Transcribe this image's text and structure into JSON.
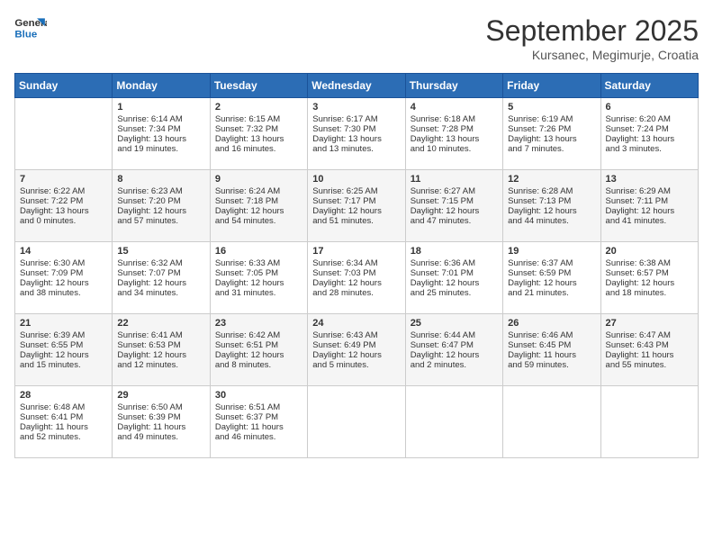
{
  "header": {
    "logo_line1": "General",
    "logo_line2": "Blue",
    "month": "September 2025",
    "location": "Kursanec, Megimurje, Croatia"
  },
  "days_of_week": [
    "Sunday",
    "Monday",
    "Tuesday",
    "Wednesday",
    "Thursday",
    "Friday",
    "Saturday"
  ],
  "weeks": [
    [
      {
        "day": "",
        "info": ""
      },
      {
        "day": "1",
        "info": "Sunrise: 6:14 AM\nSunset: 7:34 PM\nDaylight: 13 hours\nand 19 minutes."
      },
      {
        "day": "2",
        "info": "Sunrise: 6:15 AM\nSunset: 7:32 PM\nDaylight: 13 hours\nand 16 minutes."
      },
      {
        "day": "3",
        "info": "Sunrise: 6:17 AM\nSunset: 7:30 PM\nDaylight: 13 hours\nand 13 minutes."
      },
      {
        "day": "4",
        "info": "Sunrise: 6:18 AM\nSunset: 7:28 PM\nDaylight: 13 hours\nand 10 minutes."
      },
      {
        "day": "5",
        "info": "Sunrise: 6:19 AM\nSunset: 7:26 PM\nDaylight: 13 hours\nand 7 minutes."
      },
      {
        "day": "6",
        "info": "Sunrise: 6:20 AM\nSunset: 7:24 PM\nDaylight: 13 hours\nand 3 minutes."
      }
    ],
    [
      {
        "day": "7",
        "info": "Sunrise: 6:22 AM\nSunset: 7:22 PM\nDaylight: 13 hours\nand 0 minutes."
      },
      {
        "day": "8",
        "info": "Sunrise: 6:23 AM\nSunset: 7:20 PM\nDaylight: 12 hours\nand 57 minutes."
      },
      {
        "day": "9",
        "info": "Sunrise: 6:24 AM\nSunset: 7:18 PM\nDaylight: 12 hours\nand 54 minutes."
      },
      {
        "day": "10",
        "info": "Sunrise: 6:25 AM\nSunset: 7:17 PM\nDaylight: 12 hours\nand 51 minutes."
      },
      {
        "day": "11",
        "info": "Sunrise: 6:27 AM\nSunset: 7:15 PM\nDaylight: 12 hours\nand 47 minutes."
      },
      {
        "day": "12",
        "info": "Sunrise: 6:28 AM\nSunset: 7:13 PM\nDaylight: 12 hours\nand 44 minutes."
      },
      {
        "day": "13",
        "info": "Sunrise: 6:29 AM\nSunset: 7:11 PM\nDaylight: 12 hours\nand 41 minutes."
      }
    ],
    [
      {
        "day": "14",
        "info": "Sunrise: 6:30 AM\nSunset: 7:09 PM\nDaylight: 12 hours\nand 38 minutes."
      },
      {
        "day": "15",
        "info": "Sunrise: 6:32 AM\nSunset: 7:07 PM\nDaylight: 12 hours\nand 34 minutes."
      },
      {
        "day": "16",
        "info": "Sunrise: 6:33 AM\nSunset: 7:05 PM\nDaylight: 12 hours\nand 31 minutes."
      },
      {
        "day": "17",
        "info": "Sunrise: 6:34 AM\nSunset: 7:03 PM\nDaylight: 12 hours\nand 28 minutes."
      },
      {
        "day": "18",
        "info": "Sunrise: 6:36 AM\nSunset: 7:01 PM\nDaylight: 12 hours\nand 25 minutes."
      },
      {
        "day": "19",
        "info": "Sunrise: 6:37 AM\nSunset: 6:59 PM\nDaylight: 12 hours\nand 21 minutes."
      },
      {
        "day": "20",
        "info": "Sunrise: 6:38 AM\nSunset: 6:57 PM\nDaylight: 12 hours\nand 18 minutes."
      }
    ],
    [
      {
        "day": "21",
        "info": "Sunrise: 6:39 AM\nSunset: 6:55 PM\nDaylight: 12 hours\nand 15 minutes."
      },
      {
        "day": "22",
        "info": "Sunrise: 6:41 AM\nSunset: 6:53 PM\nDaylight: 12 hours\nand 12 minutes."
      },
      {
        "day": "23",
        "info": "Sunrise: 6:42 AM\nSunset: 6:51 PM\nDaylight: 12 hours\nand 8 minutes."
      },
      {
        "day": "24",
        "info": "Sunrise: 6:43 AM\nSunset: 6:49 PM\nDaylight: 12 hours\nand 5 minutes."
      },
      {
        "day": "25",
        "info": "Sunrise: 6:44 AM\nSunset: 6:47 PM\nDaylight: 12 hours\nand 2 minutes."
      },
      {
        "day": "26",
        "info": "Sunrise: 6:46 AM\nSunset: 6:45 PM\nDaylight: 11 hours\nand 59 minutes."
      },
      {
        "day": "27",
        "info": "Sunrise: 6:47 AM\nSunset: 6:43 PM\nDaylight: 11 hours\nand 55 minutes."
      }
    ],
    [
      {
        "day": "28",
        "info": "Sunrise: 6:48 AM\nSunset: 6:41 PM\nDaylight: 11 hours\nand 52 minutes."
      },
      {
        "day": "29",
        "info": "Sunrise: 6:50 AM\nSunset: 6:39 PM\nDaylight: 11 hours\nand 49 minutes."
      },
      {
        "day": "30",
        "info": "Sunrise: 6:51 AM\nSunset: 6:37 PM\nDaylight: 11 hours\nand 46 minutes."
      },
      {
        "day": "",
        "info": ""
      },
      {
        "day": "",
        "info": ""
      },
      {
        "day": "",
        "info": ""
      },
      {
        "day": "",
        "info": ""
      }
    ]
  ]
}
